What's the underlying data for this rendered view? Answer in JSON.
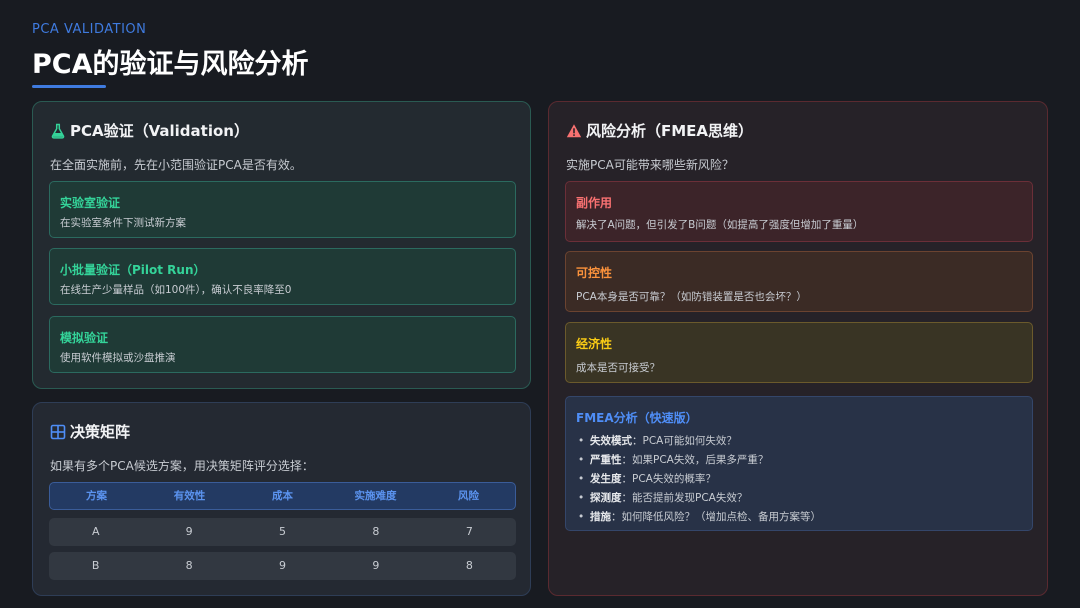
{
  "header": {
    "kicker": "PCA VALIDATION",
    "title": "PCA的验证与风险分析"
  },
  "validation": {
    "icon": "flask-icon",
    "title": "PCA验证（Validation）",
    "description": "在全面实施前，先在小范围验证PCA是否有效。",
    "items": [
      {
        "title": "实验室验证",
        "text": "在实验室条件下测试新方案"
      },
      {
        "title": "小批量验证（Pilot Run）",
        "text": "在线生产少量样品（如100件），确认不良率降至0"
      },
      {
        "title": "模拟验证",
        "text": "使用软件模拟或沙盘推演"
      }
    ],
    "accent": "#34d399"
  },
  "matrix": {
    "icon": "grid-icon",
    "title": "决策矩阵",
    "description": "如果有多个PCA候选方案，用决策矩阵评分选择：",
    "columns": [
      "方案",
      "有效性",
      "成本",
      "实施难度",
      "风险"
    ],
    "rows": [
      [
        "A",
        "9",
        "5",
        "8",
        "7"
      ],
      [
        "B",
        "8",
        "9",
        "9",
        "8"
      ]
    ]
  },
  "risk": {
    "icon": "warning-icon",
    "title": "风险分析（FMEA思维）",
    "description": "实施PCA可能带来哪些新风险？",
    "items": [
      {
        "title": "副作用",
        "text": "解决了A问题，但引发了B问题（如提高了强度但增加了重量）"
      },
      {
        "title": "可控性",
        "text": "PCA本身是否可靠？（如防错装置是否也会坏？）"
      },
      {
        "title": "经济性",
        "text": "成本是否可接受？"
      }
    ],
    "fmea": {
      "title": "FMEA分析（快速版）",
      "items": [
        {
          "label": "失效模式",
          "text": "：PCA可能如何失效？"
        },
        {
          "label": "严重性",
          "text": "：如果PCA失效，后果多严重？"
        },
        {
          "label": "发生度",
          "text": "：PCA失效的概率？"
        },
        {
          "label": "探测度",
          "text": "：能否提前发现PCA失效？"
        },
        {
          "label": "措施",
          "text": "：如何降低风险？（增加点检、备用方案等）"
        }
      ]
    }
  },
  "colors": {
    "accent_blue": "#3f7bdf",
    "green": "#34d399",
    "red": "#f87171",
    "orange": "#fb923c",
    "yellow": "#facc15"
  }
}
